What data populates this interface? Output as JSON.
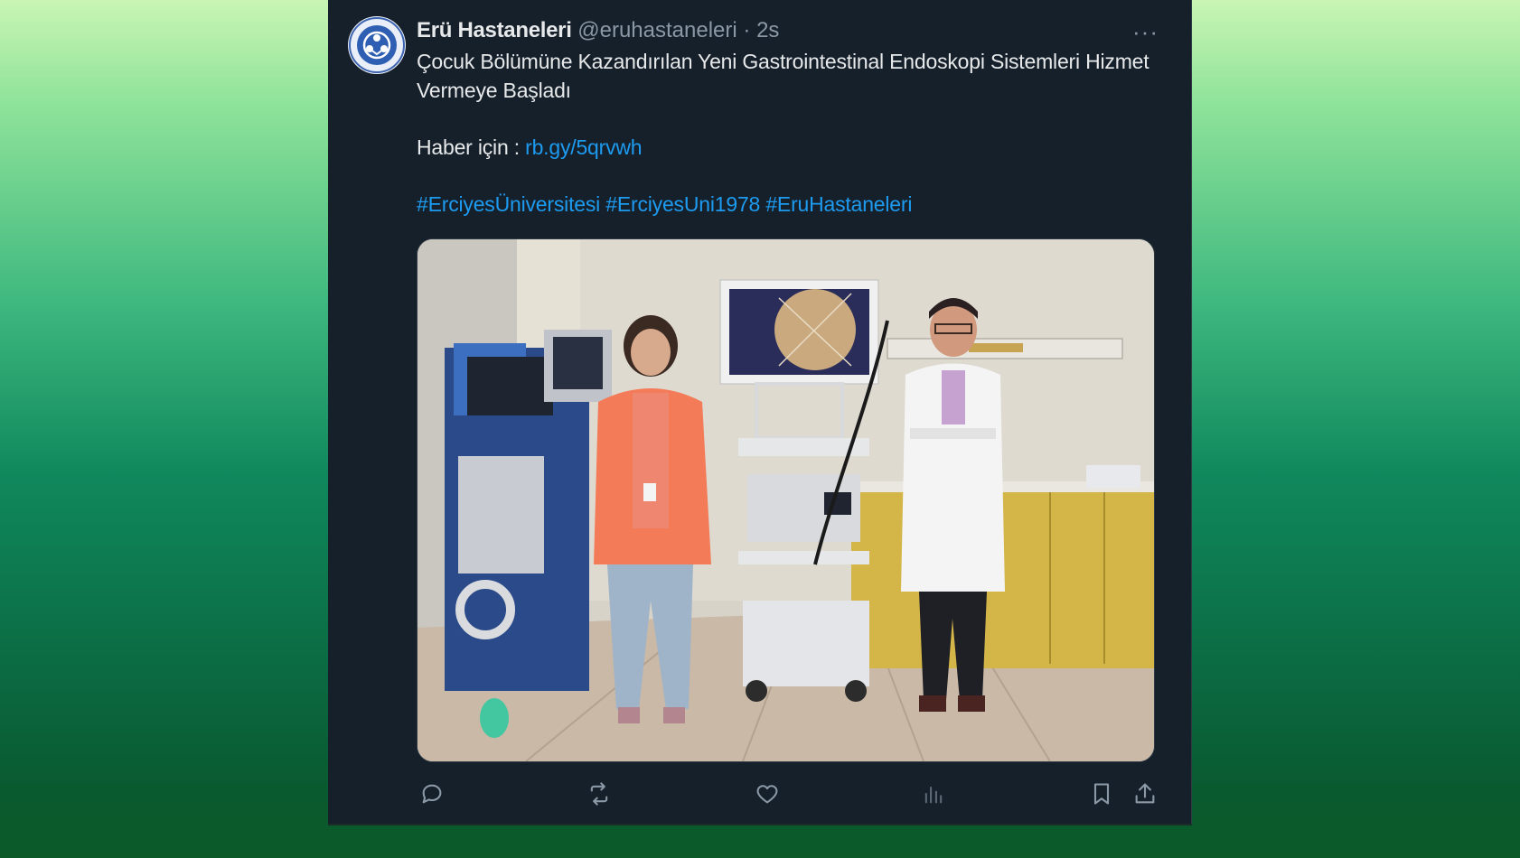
{
  "tweet": {
    "author_name": "Erü Hastaneleri",
    "handle": "@eruhastaneleri",
    "separator": "·",
    "time": "2s",
    "more_label": "···",
    "text_line1": "Çocuk Bölümüne Kazandırılan Yeni Gastrointestinal Endoskopi Sistemleri Hizmet Vermeye Başladı",
    "news_prefix": "Haber için : ",
    "news_link": "rb.gy/5qrvwh",
    "hashtags": [
      "#ErciyesÜniversitesi",
      "#ErciyesUni1978",
      "#EruHastaneleri"
    ]
  },
  "actions": [
    {
      "name": "reply",
      "icon": "reply-icon"
    },
    {
      "name": "retweet",
      "icon": "retweet-icon"
    },
    {
      "name": "like",
      "icon": "heart-icon"
    },
    {
      "name": "views",
      "icon": "views-icon"
    },
    {
      "name": "bookmark",
      "icon": "bookmark-icon"
    },
    {
      "name": "share",
      "icon": "share-icon"
    }
  ],
  "colors": {
    "tweet_bg": "#16202b",
    "text": "#e7e9ea",
    "secondary": "#8b98a5",
    "link": "#1d9bf0"
  }
}
